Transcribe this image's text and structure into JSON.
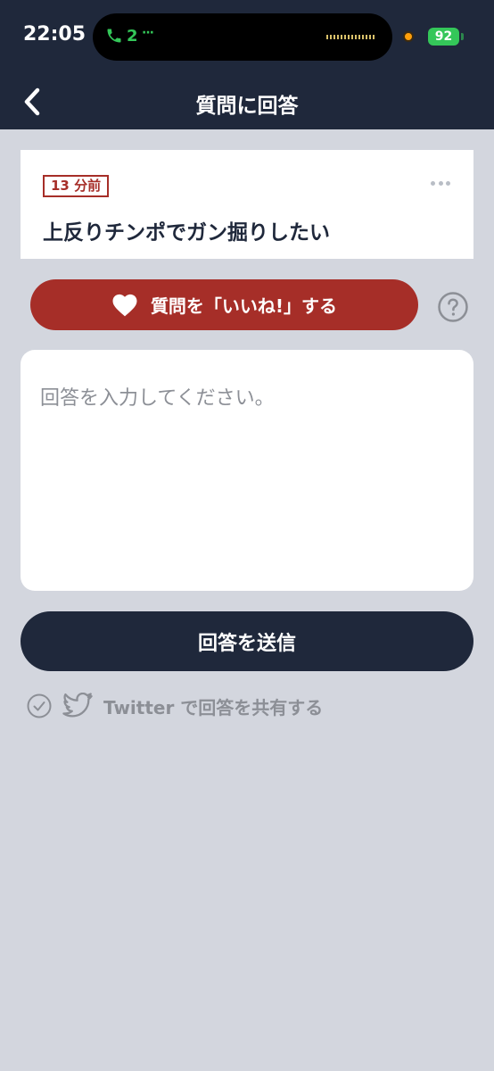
{
  "status_bar": {
    "time": "22:05",
    "call_count": "2",
    "call_more": "···",
    "battery": "92"
  },
  "nav": {
    "title": "質問に回答"
  },
  "question": {
    "time_ago": "13 分前",
    "text": "上反りチンポでガン掘りしたい"
  },
  "like_button": {
    "label": "質問を「いいね!」する"
  },
  "answer": {
    "placeholder": "回答を入力してください。"
  },
  "submit": {
    "label": "回答を送信"
  },
  "share": {
    "label": "Twitter で回答を共有する"
  },
  "colors": {
    "navy": "#1f283b",
    "red": "#a62e28",
    "background": "#d3d6de",
    "muted": "#8c8f96"
  }
}
